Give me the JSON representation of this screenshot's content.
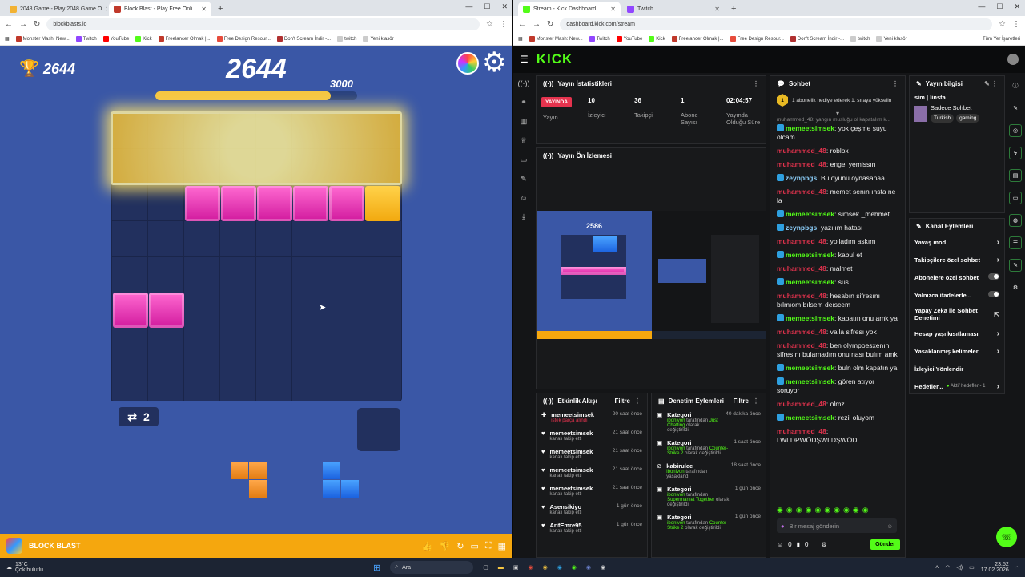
{
  "left_tabs": [
    {
      "label": "2048 Game - Play 2048 Game O",
      "color": "#f2b233"
    },
    {
      "label": "Block Blast - Play Free Onli",
      "color": "#c0392b"
    }
  ],
  "right_tabs": [
    {
      "label": "Stream - Kick Dashboard",
      "color": "#53fc18"
    },
    {
      "label": "Twitch",
      "color": "#9146ff"
    }
  ],
  "left_url": "blockblasts.io",
  "right_url": "dashboard.kick.com/stream",
  "bookmarks": [
    "Monster Mash: New...",
    "Twitch",
    "YouTube",
    "Kick",
    "Freelancer Olmak |...",
    "Free Design Resour...",
    "Don't Scream İndir -...",
    "twitch",
    "Yeni klasör"
  ],
  "bookmarks_right": "Tüm Yer İşaretleri",
  "game": {
    "best": "2644",
    "score": "2644",
    "target": "3000",
    "progress": 0.87,
    "swaps": "2",
    "brand": "BLOCK BLAST"
  },
  "kick": {
    "logo": "KICK",
    "stats_title": "Yayın İstatistikleri",
    "live": "YAYINDA",
    "stat_live_label": "Yayın",
    "stats": [
      {
        "value": "10",
        "label": "İzleyici"
      },
      {
        "value": "36",
        "label": "Takipçi"
      },
      {
        "value": "1",
        "label": "Abone Sayısı"
      },
      {
        "value": "02:04:57",
        "label": "Yayında Olduğu Süre"
      }
    ],
    "preview_title": "Yayın Ön İzlemesi",
    "preview_score": "2586",
    "chat_title": "Sohbet",
    "goal_text": "1 abonelik hediye ederek 1. sıraya yükselin",
    "goal_rank": "1",
    "chat_top_faded": "muhammed_48: yangın musluğu ol kapatalım k...",
    "chat": [
      {
        "user": "memeetsimsek",
        "color": "g",
        "text": "yok çeşme suyu olcam"
      },
      {
        "user": "muhammed_48",
        "color": "r",
        "text": "roblox"
      },
      {
        "user": "muhammed_48",
        "color": "r",
        "text": "engel yemissın"
      },
      {
        "user": "zeynpbgs",
        "color": "b",
        "text": "Bu oyunu oynasanaa"
      },
      {
        "user": "muhammed_48",
        "color": "r",
        "text": "memet senın ınsta ne la"
      },
      {
        "user": "memeetsimsek",
        "color": "g",
        "text": "simsek._mehmet"
      },
      {
        "user": "zeynpbgs",
        "color": "b",
        "text": "yazılım hatası"
      },
      {
        "user": "muhammed_48",
        "color": "r",
        "text": "yolladım askım"
      },
      {
        "user": "memeetsimsek",
        "color": "g",
        "text": "kabul et"
      },
      {
        "user": "muhammed_48",
        "color": "r",
        "text": "malmet"
      },
      {
        "user": "memeetsimsek",
        "color": "g",
        "text": "sus"
      },
      {
        "user": "muhammed_48",
        "color": "r",
        "text": "hesabın sifresını bılmıom bılsem deıscem"
      },
      {
        "user": "memeetsimsek",
        "color": "g",
        "text": "kapatın onu amk ya"
      },
      {
        "user": "muhammed_48",
        "color": "r",
        "text": "valla sifresı yok"
      },
      {
        "user": "muhammed_48",
        "color": "r",
        "text": "ben olympoesxenın sifresını bulamadım onu nası bulım amk"
      },
      {
        "user": "memeetsimsek",
        "color": "g",
        "text": "buln olm kapatın ya"
      },
      {
        "user": "memeetsimsek",
        "color": "g",
        "text": "gören atıyor soruyor"
      },
      {
        "user": "muhammed_48",
        "color": "r",
        "text": "olmz"
      },
      {
        "user": "memeetsimsek",
        "color": "g",
        "text": "rezil oluyom"
      },
      {
        "user": "muhammed_48",
        "color": "r",
        "text": "LWLDPWÖDŞWLDŞWÖDL"
      }
    ],
    "chat_placeholder": "Bir mesaj gönderin",
    "send": "Gönder",
    "chat_counts": [
      "0",
      "0"
    ],
    "info_title": "Yayın bilgisi",
    "stream_title": "sim | linsta",
    "category": "Sadece Sohbet",
    "tags": [
      "Turkish",
      "gaming"
    ],
    "channel_actions_title": "Kanal Eylemleri",
    "channel_actions": [
      {
        "label": "Yavaş mod",
        "kind": "chevron"
      },
      {
        "label": "Takipçilere özel sohbet",
        "kind": "chevron"
      },
      {
        "label": "Abonelere özel sohbet",
        "kind": "toggle"
      },
      {
        "label": "Yalnızca ifadelerle...",
        "kind": "toggle"
      },
      {
        "label": "Yapay Zeka ile Sohbet Denetimi",
        "kind": "ext"
      },
      {
        "label": "Hesap yaşı kısıtlaması",
        "kind": "chevron"
      },
      {
        "label": "Yasaklanmış kelimeler",
        "kind": "chevron"
      },
      {
        "label": "İzleyici Yönlendir",
        "kind": "none"
      },
      {
        "label": "Hedefler...",
        "kind": "goal"
      }
    ],
    "goal_active": "Aktif hedefler - 1",
    "activity_title": "Etkinlik Akışı",
    "mod_title": "Denetim Eylemleri",
    "filter": "Filtre",
    "activity": [
      {
        "user": "memeetsimsek",
        "sub": "istek parça alındı",
        "time": "20 saat önce",
        "hl": true
      },
      {
        "user": "memeetsimsek",
        "sub": "kanalı takip etti",
        "time": "21 saat önce"
      },
      {
        "user": "memeetsimsek",
        "sub": "kanalı takip etti",
        "time": "21 saat önce"
      },
      {
        "user": "memeetsimsek",
        "sub": "kanalı takip etti",
        "time": "21 saat önce"
      },
      {
        "user": "memeetsimsek",
        "sub": "kanalı takip etti",
        "time": "21 saat önce"
      },
      {
        "user": "Asensikiyo",
        "sub": "kanalı takip etti",
        "time": "1 gün önce"
      },
      {
        "user": "ArifEmre95",
        "sub": "kanalı takip etti",
        "time": "1 gün önce"
      }
    ],
    "mod": [
      {
        "title": "Kategori",
        "by": "ibonivon",
        "mid": "tarafından",
        "val": "Just Chatting",
        "end": "olarak değiştirildi",
        "time": "40 dakika önce"
      },
      {
        "title": "Kategori",
        "by": "ibonivon",
        "mid": "tarafından",
        "val": "Counter-Strike 2",
        "end": "olarak değiştirildi",
        "time": "1 saat önce"
      },
      {
        "title": "kabirulee",
        "by": "ibonivon",
        "mid": "tarafından yasaklandı",
        "val": "",
        "end": "",
        "time": "18 saat önce"
      },
      {
        "title": "Kategori",
        "by": "ibonivon",
        "mid": "tarafından",
        "val": "Supermarket Together",
        "end": "olarak değiştirildi",
        "time": "1 gün önce"
      },
      {
        "title": "Kategori",
        "by": "ibonivon",
        "mid": "tarafından",
        "val": "Counter-Strike 2",
        "end": "olarak değiştirildi",
        "time": "1 gün önce"
      }
    ]
  },
  "taskbar": {
    "weather_temp": "13°C",
    "weather_text": "Çok bulutlu",
    "search": "Ara",
    "time": "23:52",
    "date": "17.02.2026"
  }
}
